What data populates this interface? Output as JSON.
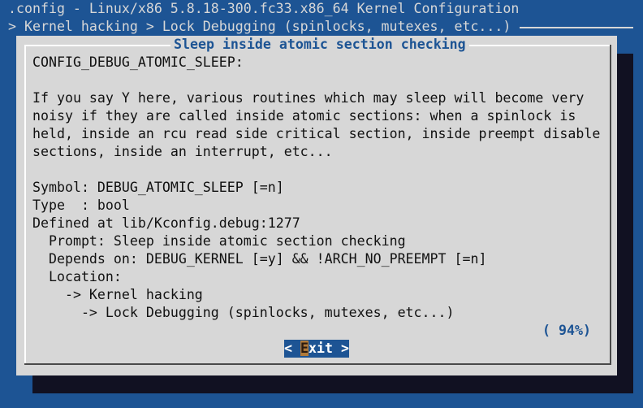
{
  "window": {
    "title": ".config - Linux/x86 5.8.18-300.fc33.x86_64 Kernel Configuration",
    "breadcrumb": "> Kernel hacking > Lock Debugging (spinlocks, mutexes, etc...)"
  },
  "dialog": {
    "title": "Sleep inside atomic section checking",
    "help_text": "CONFIG_DEBUG_ATOMIC_SLEEP:\n\nIf you say Y here, various routines which may sleep will become very\nnoisy if they are called inside atomic sections: when a spinlock is\nheld, inside an rcu read side critical section, inside preempt disable\nsections, inside an interrupt, etc...\n\nSymbol: DEBUG_ATOMIC_SLEEP [=n]\nType  : bool\nDefined at lib/Kconfig.debug:1277\n  Prompt: Sleep inside atomic section checking\n  Depends on: DEBUG_KERNEL [=y] && !ARCH_NO_PREEMPT [=n]\n  Location:\n    -> Kernel hacking\n      -> Lock Debugging (spinlocks, mutexes, etc...)",
    "scroll_percent": "( 94%)",
    "exit_button": {
      "prefix": "< ",
      "hotkey": "E",
      "rest": "xit",
      "suffix": " >"
    }
  },
  "colors": {
    "background": "#1d5494",
    "dialog": "#d7d7d7",
    "accent": "#1d5494",
    "hotkey": "#b07a3a"
  }
}
